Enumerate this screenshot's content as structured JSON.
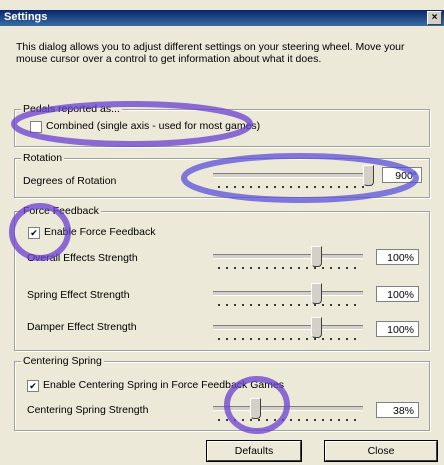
{
  "window": {
    "title": "Settings",
    "close_glyph": "×"
  },
  "intro_text": "This dialog allows you to adjust different settings on your steering wheel.  Move your mouse cursor over a control to get information about what it does.",
  "pedals": {
    "legend": "Pedals reported as...",
    "combined_label": "Combined (single axis - used for most games)",
    "combined_checked": false
  },
  "rotation": {
    "legend": "Rotation",
    "degrees_label": "Degrees of Rotation",
    "degrees_value": "900°",
    "slider_level": 1.0
  },
  "force_feedback": {
    "legend": "Force Feedback",
    "enable_label": "Enable Force Feedback",
    "enable_checked": true,
    "rows": [
      {
        "label": "Overall Effects Strength",
        "value": "100%",
        "level": 0.67
      },
      {
        "label": "Spring Effect Strength",
        "value": "100%",
        "level": 0.67
      },
      {
        "label": "Damper Effect Strength",
        "value": "100%",
        "level": 0.67
      }
    ]
  },
  "centering": {
    "legend": "Centering Spring",
    "enable_label": "Enable Centering Spring in Force Feedback Games",
    "enable_checked": true,
    "strength_label": "Centering Spring Strength",
    "strength_value": "38%",
    "level": 0.25
  },
  "buttons": {
    "defaults": "Defaults",
    "close": "Close"
  },
  "check_glyph": "✔"
}
